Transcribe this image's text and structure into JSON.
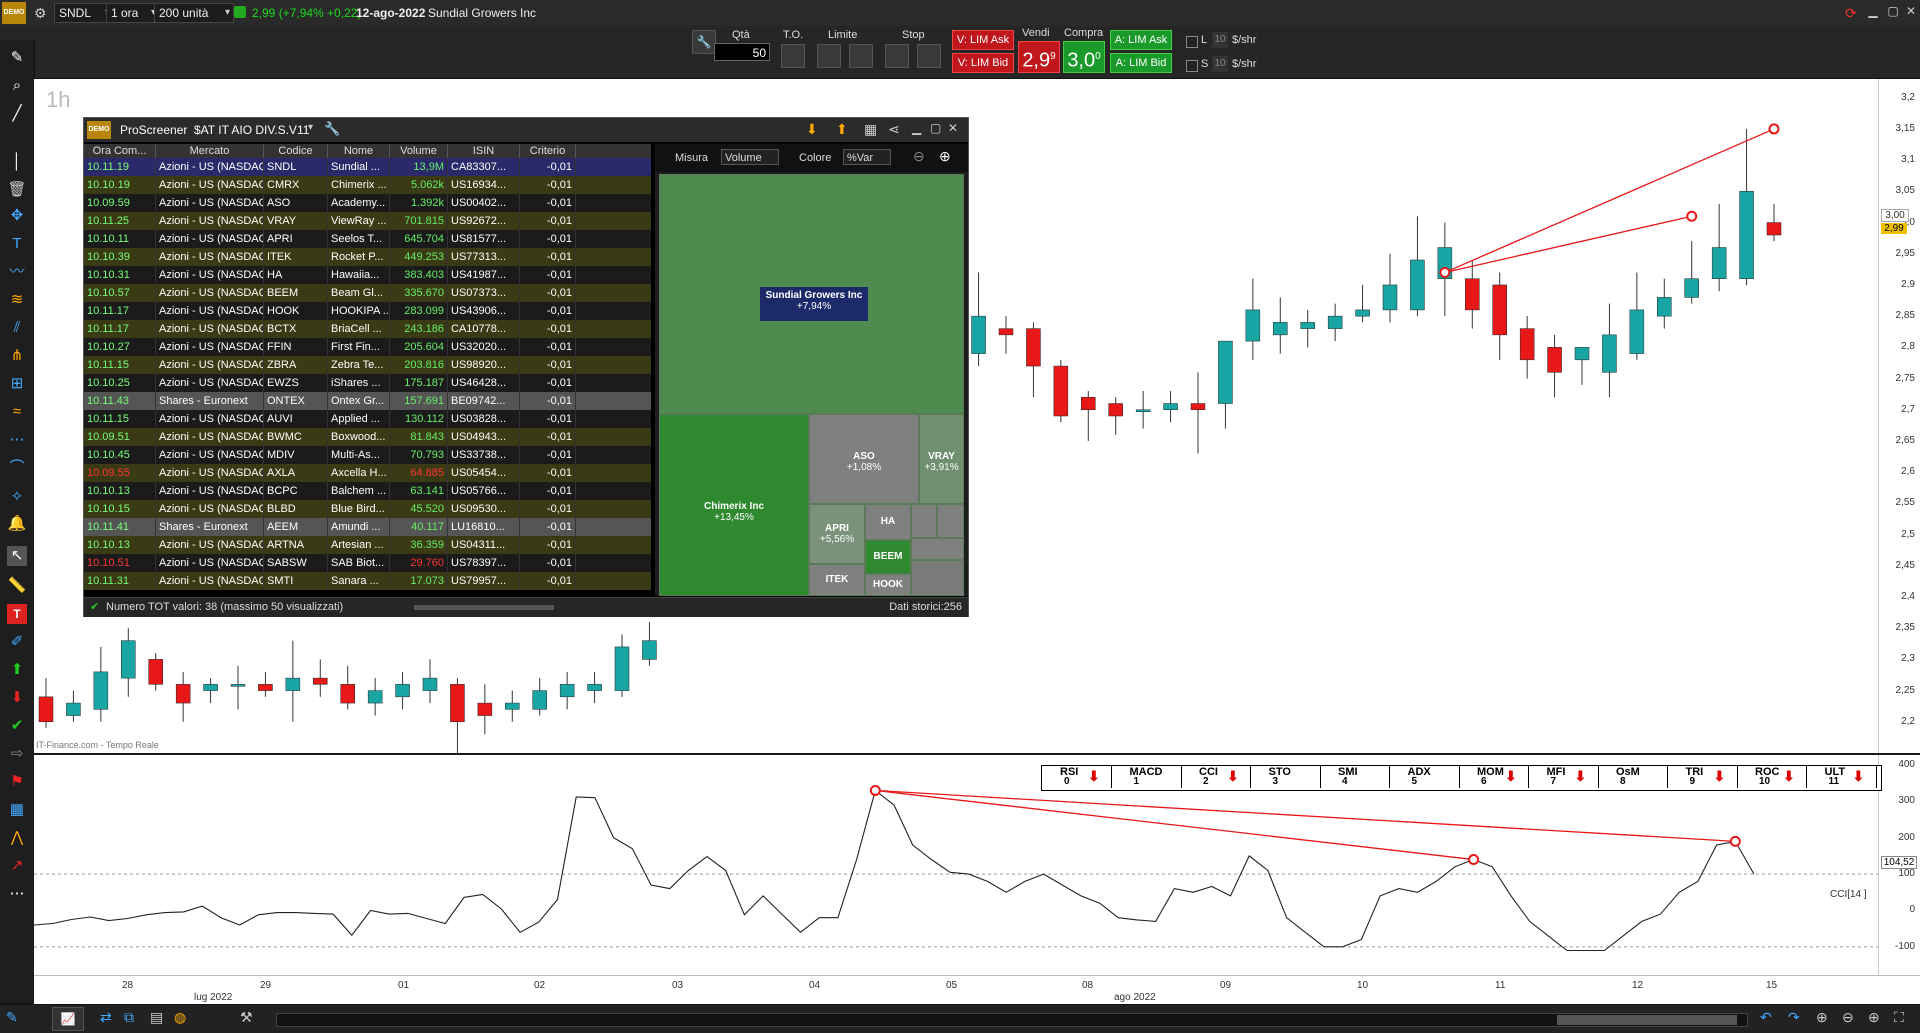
{
  "topbar": {
    "ticker": "SNDL",
    "timeframe": "1 ora",
    "units": "200 unità",
    "price_info": "2,99 (+7,94% +0,22)",
    "date": "12-ago-2022",
    "company": "Sundial Growers Inc"
  },
  "orderbar": {
    "qty_label": "Qtà",
    "qty_value": "50",
    "to_label": "T.O.",
    "limite_label": "Limite",
    "stop_label": "Stop",
    "v_lim_ask": "V: LIM Ask",
    "v_lim_bid": "V: LIM Bid",
    "vendi_label": "Vendi",
    "vendi_price": "2,9",
    "vendi_sup": "9",
    "compra_label": "Compra",
    "compra_price": "3,0",
    "compra_sup": "0",
    "a_lim_ask": "A: LIM Ask",
    "a_lim_bid": "A: LIM Bid",
    "l_label": "L",
    "s_label": "S",
    "l_val": "10",
    "s_val": "10",
    "shr1": "$/shr",
    "shr2": "$/shr"
  },
  "chart": {
    "timeframe_label": "1h",
    "source": "IT-Finance.com - Tempo Reale",
    "price_ticks": [
      "3,2",
      "3,15",
      "3,1",
      "3,05",
      "3,0",
      "2,95",
      "2,9",
      "2,85",
      "2,8",
      "2,75",
      "2,7",
      "2,65",
      "2,6",
      "2,55",
      "2,5",
      "2,45",
      "2,4",
      "2,35",
      "2,3",
      "2,25",
      "2,2"
    ],
    "last_price_tag": "2,99",
    "prev_tag": "3,00",
    "ind_ticks": [
      "400",
      "300",
      "200",
      "100",
      "0",
      "-100"
    ],
    "ind_value_tag": "104,52",
    "ind_name": "CCI[14 ]",
    "x_ticks": [
      "28",
      "29",
      "01",
      "02",
      "03",
      "04",
      "05",
      "08",
      "09",
      "10",
      "11",
      "12",
      "15"
    ],
    "month_labels": [
      "lug 2022",
      "ago 2022"
    ]
  },
  "chart_data": {
    "type": "candlestick",
    "y_range": [
      2.15,
      3.23
    ],
    "candles": [
      {
        "o": 2.24,
        "h": 2.27,
        "l": 2.19,
        "c": 2.2
      },
      {
        "o": 2.21,
        "h": 2.25,
        "l": 2.2,
        "c": 2.23
      },
      {
        "o": 2.22,
        "h": 2.32,
        "l": 2.2,
        "c": 2.28
      },
      {
        "o": 2.27,
        "h": 2.35,
        "l": 2.24,
        "c": 2.33
      },
      {
        "o": 2.3,
        "h": 2.31,
        "l": 2.25,
        "c": 2.26
      },
      {
        "o": 2.26,
        "h": 2.28,
        "l": 2.2,
        "c": 2.23
      },
      {
        "o": 2.25,
        "h": 2.27,
        "l": 2.23,
        "c": 2.26
      },
      {
        "o": 2.26,
        "h": 2.29,
        "l": 2.22,
        "c": 2.26
      },
      {
        "o": 2.26,
        "h": 2.28,
        "l": 2.24,
        "c": 2.25
      },
      {
        "o": 2.25,
        "h": 2.33,
        "l": 2.2,
        "c": 2.27
      },
      {
        "o": 2.27,
        "h": 2.3,
        "l": 2.24,
        "c": 2.26
      },
      {
        "o": 2.26,
        "h": 2.29,
        "l": 2.22,
        "c": 2.23
      },
      {
        "o": 2.23,
        "h": 2.27,
        "l": 2.21,
        "c": 2.25
      },
      {
        "o": 2.24,
        "h": 2.28,
        "l": 2.22,
        "c": 2.26
      },
      {
        "o": 2.25,
        "h": 2.3,
        "l": 2.23,
        "c": 2.27
      },
      {
        "o": 2.26,
        "h": 2.27,
        "l": 2.15,
        "c": 2.2
      },
      {
        "o": 2.23,
        "h": 2.26,
        "l": 2.18,
        "c": 2.21
      },
      {
        "o": 2.22,
        "h": 2.25,
        "l": 2.2,
        "c": 2.23
      },
      {
        "o": 2.22,
        "h": 2.27,
        "l": 2.21,
        "c": 2.25
      },
      {
        "o": 2.24,
        "h": 2.28,
        "l": 2.22,
        "c": 2.26
      },
      {
        "o": 2.25,
        "h": 2.28,
        "l": 2.23,
        "c": 2.26
      },
      {
        "o": 2.25,
        "h": 2.34,
        "l": 2.24,
        "c": 2.32
      },
      {
        "o": 2.3,
        "h": 2.36,
        "l": 2.29,
        "c": 2.33
      },
      {
        "o": 2.51,
        "h": 2.53,
        "l": 2.49,
        "c": 2.5
      },
      {
        "o": 2.5,
        "h": 2.51,
        "l": 2.48,
        "c": 2.49
      },
      {
        "o": 2.5,
        "h": 2.51,
        "l": 2.48,
        "c": 2.5
      },
      {
        "o": 2.5,
        "h": 2.51,
        "l": 2.48,
        "c": 2.49
      },
      {
        "o": 2.49,
        "h": 2.51,
        "l": 2.48,
        "c": 2.48
      },
      {
        "o": 2.49,
        "h": 2.52,
        "l": 2.47,
        "c": 2.51
      },
      {
        "o": 2.51,
        "h": 2.62,
        "l": 2.47,
        "c": 2.6
      },
      {
        "o": 2.6,
        "h": 2.8,
        "l": 2.55,
        "c": 2.76
      },
      {
        "o": 2.74,
        "h": 2.85,
        "l": 2.65,
        "c": 2.79
      },
      {
        "o": 2.73,
        "h": 2.84,
        "l": 2.72,
        "c": 2.79
      },
      {
        "o": 2.78,
        "h": 2.85,
        "l": 2.74,
        "c": 2.83
      },
      {
        "o": 2.79,
        "h": 2.92,
        "l": 2.77,
        "c": 2.85
      },
      {
        "o": 2.83,
        "h": 2.85,
        "l": 2.79,
        "c": 2.82
      },
      {
        "o": 2.83,
        "h": 2.84,
        "l": 2.72,
        "c": 2.77
      },
      {
        "o": 2.77,
        "h": 2.78,
        "l": 2.68,
        "c": 2.69
      },
      {
        "o": 2.72,
        "h": 2.73,
        "l": 2.65,
        "c": 2.7
      },
      {
        "o": 2.71,
        "h": 2.72,
        "l": 2.66,
        "c": 2.69
      },
      {
        "o": 2.7,
        "h": 2.73,
        "l": 2.67,
        "c": 2.7
      },
      {
        "o": 2.7,
        "h": 2.73,
        "l": 2.68,
        "c": 2.71
      },
      {
        "o": 2.71,
        "h": 2.76,
        "l": 2.63,
        "c": 2.7
      },
      {
        "o": 2.71,
        "h": 2.79,
        "l": 2.67,
        "c": 2.81
      },
      {
        "o": 2.81,
        "h": 2.91,
        "l": 2.78,
        "c": 2.86
      },
      {
        "o": 2.82,
        "h": 2.88,
        "l": 2.79,
        "c": 2.84
      },
      {
        "o": 2.83,
        "h": 2.86,
        "l": 2.8,
        "c": 2.84
      },
      {
        "o": 2.83,
        "h": 2.87,
        "l": 2.81,
        "c": 2.85
      },
      {
        "o": 2.85,
        "h": 2.9,
        "l": 2.84,
        "c": 2.86
      },
      {
        "o": 2.86,
        "h": 2.95,
        "l": 2.84,
        "c": 2.9
      },
      {
        "o": 2.86,
        "h": 3.01,
        "l": 2.85,
        "c": 2.94
      },
      {
        "o": 2.91,
        "h": 3.0,
        "l": 2.85,
        "c": 2.96
      },
      {
        "o": 2.91,
        "h": 2.94,
        "l": 2.83,
        "c": 2.86
      },
      {
        "o": 2.9,
        "h": 2.92,
        "l": 2.78,
        "c": 2.82
      },
      {
        "o": 2.83,
        "h": 2.85,
        "l": 2.75,
        "c": 2.78
      },
      {
        "o": 2.8,
        "h": 2.82,
        "l": 2.72,
        "c": 2.76
      },
      {
        "o": 2.78,
        "h": 2.8,
        "l": 2.74,
        "c": 2.8
      },
      {
        "o": 2.76,
        "h": 2.87,
        "l": 2.72,
        "c": 2.82
      },
      {
        "o": 2.79,
        "h": 2.92,
        "l": 2.78,
        "c": 2.86
      },
      {
        "o": 2.85,
        "h": 2.91,
        "l": 2.83,
        "c": 2.88
      },
      {
        "o": 2.88,
        "h": 2.97,
        "l": 2.87,
        "c": 2.91
      },
      {
        "o": 2.91,
        "h": 3.03,
        "l": 2.89,
        "c": 2.96
      },
      {
        "o": 2.91,
        "h": 3.15,
        "l": 2.9,
        "c": 3.05
      },
      {
        "o": 3.0,
        "h": 3.03,
        "l": 2.97,
        "c": 2.98
      }
    ],
    "cci": [
      -40,
      -36,
      -25,
      -18,
      -28,
      -22,
      -12,
      -6,
      -4,
      12,
      -20,
      -40,
      -12,
      -6,
      -6,
      -8,
      -10,
      -68,
      0,
      -10,
      -8,
      -22,
      -36,
      36,
      44,
      4,
      -60,
      -32,
      30,
      312,
      310,
      200,
      170,
      70,
      60,
      110,
      148,
      110,
      -12,
      40,
      -10,
      -60,
      -20,
      -20,
      140,
      330,
      290,
      180,
      140,
      105,
      100,
      80,
      50,
      80,
      100,
      70,
      40,
      20,
      -20,
      -26,
      -30,
      60,
      50,
      66,
      40,
      150,
      110,
      -20,
      -60,
      -100,
      -100,
      -80,
      40,
      60,
      50,
      80,
      120,
      140,
      120,
      40,
      -30,
      -70,
      -110,
      -110,
      -110,
      -70,
      -30,
      -10,
      50,
      80,
      180,
      190,
      100
    ],
    "cci_range": [
      -150,
      400
    ]
  },
  "screener": {
    "logo": "DEMO",
    "title": "ProScreener",
    "list_name": "$AT IT AIO DIV.S.V11",
    "columns": [
      "Ora Com...",
      "Mercato",
      "Codice",
      "Nome",
      "Volume",
      "ISIN",
      "Criterio"
    ],
    "measure_label": "Misura",
    "measure_value": "Volume",
    "color_label": "Colore",
    "color_value": "%Var",
    "footer_left": "Numero TOT valori: 38 (massimo 50 visualizzati)",
    "footer_right": "Dati storici:256",
    "rows": [
      {
        "time": "10.11.19",
        "market": "Azioni - US (NASDAQ",
        "code": "SNDL",
        "name": "Sundial ...",
        "vol": "13,9M",
        "isin": "CA83307...",
        "crit": "-0,01"
      },
      {
        "time": "10.10.19",
        "market": "Azioni - US (NASDAQ",
        "code": "CMRX",
        "name": "Chimerix ...",
        "vol": "5.062k",
        "isin": "US16934...",
        "crit": "-0,01"
      },
      {
        "time": "10.09.59",
        "market": "Azioni - US (NASDAQ",
        "code": "ASO",
        "name": "Academy...",
        "vol": "1.392k",
        "isin": "US00402...",
        "crit": "-0,01"
      },
      {
        "time": "10.11.25",
        "market": "Azioni - US (NASDAQ",
        "code": "VRAY",
        "name": "ViewRay ...",
        "vol": "701.815",
        "isin": "US92672...",
        "crit": "-0,01"
      },
      {
        "time": "10.10.11",
        "market": "Azioni - US (NASDAQ",
        "code": "APRI",
        "name": "Seelos T...",
        "vol": "645.704",
        "isin": "US81577...",
        "crit": "-0,01"
      },
      {
        "time": "10.10.39",
        "market": "Azioni - US (NASDAQ",
        "code": "ITEK",
        "name": "Rocket P...",
        "vol": "449.253",
        "isin": "US77313...",
        "crit": "-0,01"
      },
      {
        "time": "10.10.31",
        "market": "Azioni - US (NASDAQ",
        "code": "HA",
        "name": "Hawaiia...",
        "vol": "383.403",
        "isin": "US41987...",
        "crit": "-0,01"
      },
      {
        "time": "10.10.57",
        "market": "Azioni - US (NASDAQ",
        "code": "BEEM",
        "name": "Beam Gl...",
        "vol": "335.670",
        "isin": "US07373...",
        "crit": "-0,01"
      },
      {
        "time": "10.11.17",
        "market": "Azioni - US (NASDAQ",
        "code": "HOOK",
        "name": "HOOKIPA ...",
        "vol": "283.099",
        "isin": "US43906...",
        "crit": "-0,01"
      },
      {
        "time": "10.11.17",
        "market": "Azioni - US (NASDAQ",
        "code": "BCTX",
        "name": "BriaCell ...",
        "vol": "243.186",
        "isin": "CA10778...",
        "crit": "-0,01"
      },
      {
        "time": "10.10.27",
        "market": "Azioni - US (NASDAQ",
        "code": "FFIN",
        "name": "First Fin...",
        "vol": "205.604",
        "isin": "US32020...",
        "crit": "-0,01"
      },
      {
        "time": "10.11.15",
        "market": "Azioni - US (NASDAQ",
        "code": "ZBRA",
        "name": "Zebra Te...",
        "vol": "203.816",
        "isin": "US98920...",
        "crit": "-0,01"
      },
      {
        "time": "10.10.25",
        "market": "Azioni - US (NASDAQ",
        "code": "EWZS",
        "name": "iShares ...",
        "vol": "175.187",
        "isin": "US46428...",
        "crit": "-0,01"
      },
      {
        "time": "10.11.43",
        "market": "Shares - Euronext",
        "code": "ONTEX",
        "name": "Ontex Gr...",
        "vol": "157.691",
        "isin": "BE09742...",
        "crit": "-0,01"
      },
      {
        "time": "10.11.15",
        "market": "Azioni - US (NASDAQ",
        "code": "AUVI",
        "name": "Applied ...",
        "vol": "130.112",
        "isin": "US03828...",
        "crit": "-0,01"
      },
      {
        "time": "10.09.51",
        "market": "Azioni - US (NASDAQ",
        "code": "BWMC",
        "name": "Boxwood...",
        "vol": "81.843",
        "isin": "US04943...",
        "crit": "-0,01"
      },
      {
        "time": "10.10.45",
        "market": "Azioni - US (NASDAQ",
        "code": "MDIV",
        "name": "Multi-As...",
        "vol": "70.793",
        "isin": "US33738...",
        "crit": "-0,01"
      },
      {
        "time": "10.09.55",
        "market": "Azioni - US (NASDAQ",
        "code": "AXLA",
        "name": "Axcella H...",
        "vol": "64.885",
        "isin": "US05454...",
        "crit": "-0,01"
      },
      {
        "time": "10.10.13",
        "market": "Azioni - US (NASDAQ",
        "code": "BCPC",
        "name": "Balchem ...",
        "vol": "63.141",
        "isin": "US05766...",
        "crit": "-0,01"
      },
      {
        "time": "10.10.15",
        "market": "Azioni - US (NASDAQ",
        "code": "BLBD",
        "name": "Blue Bird...",
        "vol": "45.520",
        "isin": "US09530...",
        "crit": "-0,01"
      },
      {
        "time": "10.11.41",
        "market": "Shares - Euronext",
        "code": "AEEM",
        "name": "Amundi ...",
        "vol": "40.117",
        "isin": "LU16810...",
        "crit": "-0,01"
      },
      {
        "time": "10.10.13",
        "market": "Azioni - US (NASDAQ",
        "code": "ARTNA",
        "name": "Artesian ...",
        "vol": "36.359",
        "isin": "US04311...",
        "crit": "-0,01"
      },
      {
        "time": "10.10.51",
        "market": "Azioni - US (NASDAQ",
        "code": "SABSW",
        "name": "SAB Biot...",
        "vol": "29.760",
        "isin": "US78397...",
        "crit": "-0,01"
      },
      {
        "time": "10.11.31",
        "market": "Azioni - US (NASDAQ",
        "code": "SMTI",
        "name": "Sanara ...",
        "vol": "17.073",
        "isin": "US79957...",
        "crit": "-0,01"
      }
    ],
    "treemap": {
      "sndl_name": "Sundial Growers Inc",
      "sndl_pct": "+7,94%",
      "cmrx_name": "Chimerix Inc",
      "cmrx_pct": "+13,45%",
      "aso_name": "ASO",
      "aso_pct": "+1,08%",
      "vray_name": "VRAY",
      "vray_pct": "+3,91%",
      "apri_name": "APRI",
      "apri_pct": "+5,56%",
      "ha_name": "HA",
      "beem_name": "BEEM",
      "itek_name": "ITEK",
      "hook_name": "HOOK"
    }
  },
  "indicator_tabs": [
    {
      "name": "RSI",
      "num": "0",
      "arrow": true
    },
    {
      "name": "MACD",
      "num": "1",
      "arrow": false
    },
    {
      "name": "CCI",
      "num": "2",
      "arrow": true
    },
    {
      "name": "STO",
      "num": "3",
      "arrow": false
    },
    {
      "name": "SMI",
      "num": "4",
      "arrow": false
    },
    {
      "name": "ADX",
      "num": "5",
      "arrow": false
    },
    {
      "name": "MOM",
      "num": "6",
      "arrow": true
    },
    {
      "name": "MFI",
      "num": "7",
      "arrow": true
    },
    {
      "name": "OsM",
      "num": "8",
      "arrow": false
    },
    {
      "name": "TRI",
      "num": "9",
      "arrow": true
    },
    {
      "name": "ROC",
      "num": "10",
      "arrow": true
    },
    {
      "name": "ULT",
      "num": "11",
      "arrow": true
    }
  ],
  "colors": {
    "up": "#1aa5a5",
    "down": "#e81818",
    "signal": "#e81818"
  }
}
